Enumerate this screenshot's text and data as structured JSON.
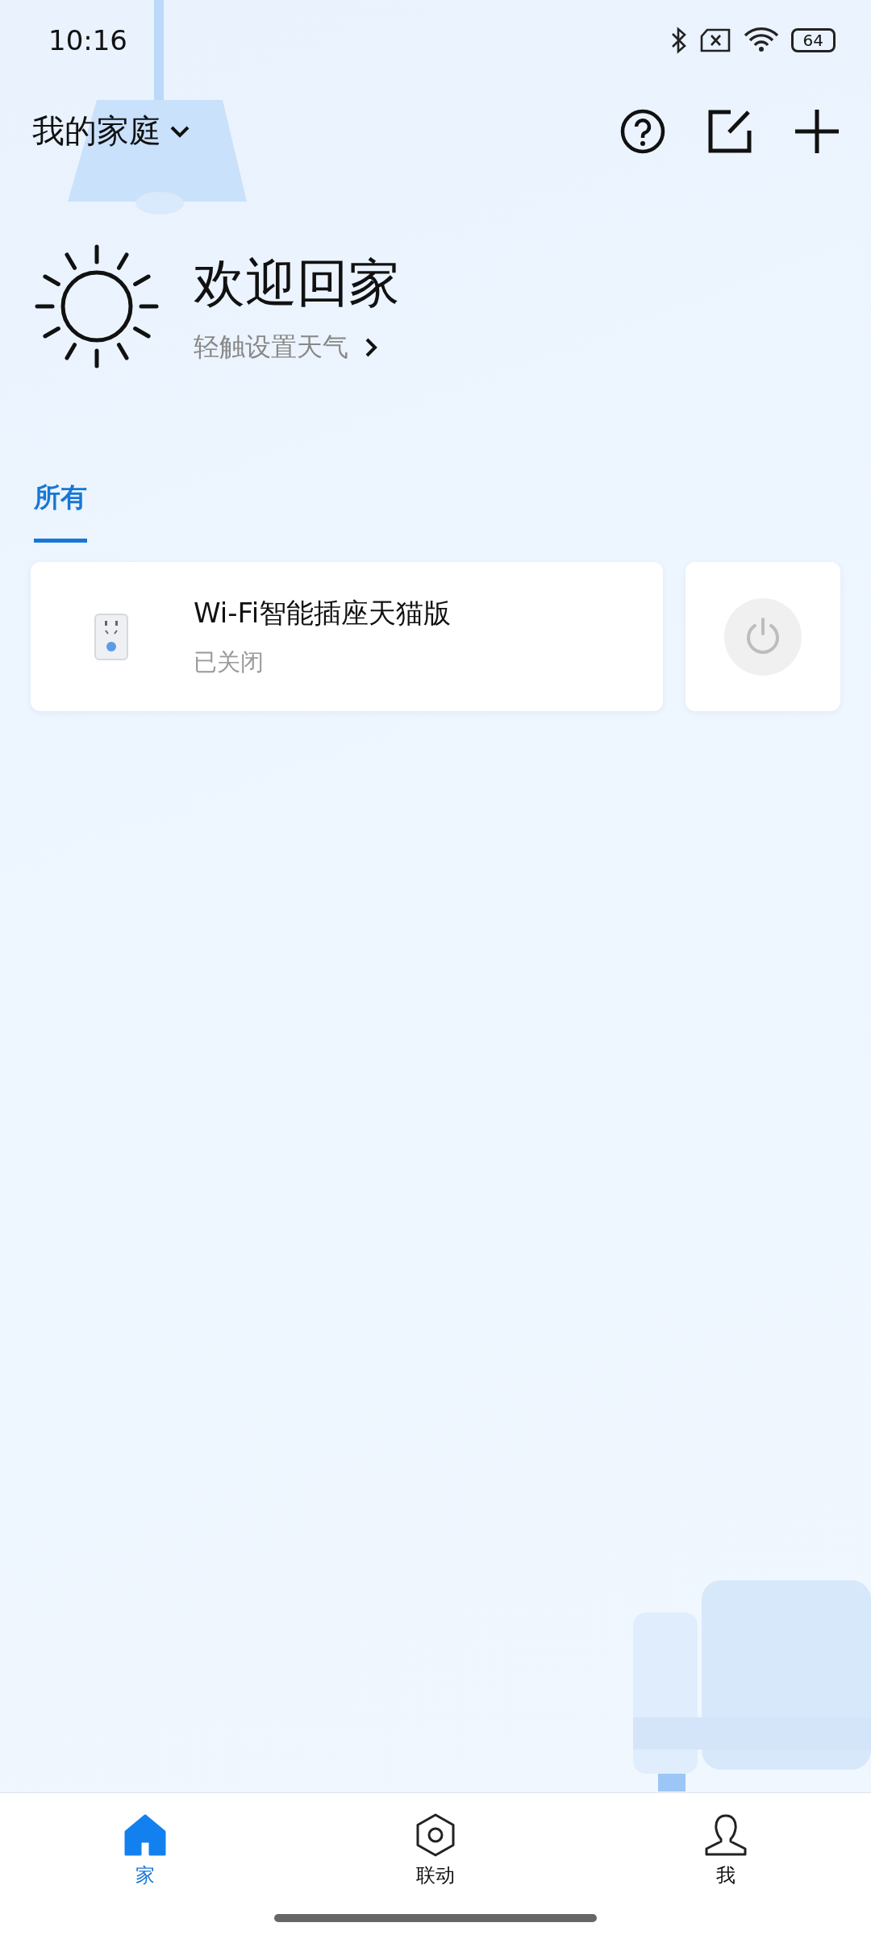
{
  "status_bar": {
    "time": "10:16",
    "battery": "64"
  },
  "header": {
    "home_name": "我的家庭"
  },
  "weather": {
    "title": "欢迎回家",
    "subtitle": "轻触设置天气"
  },
  "room_tabs": [
    {
      "label": "所有",
      "selected": true
    }
  ],
  "devices": [
    {
      "name": "Wi-Fi智能插座天猫版",
      "status": "已关闭",
      "on": false
    }
  ],
  "bottom_nav": [
    {
      "label": "家",
      "kind": "home",
      "selected": true
    },
    {
      "label": "联动",
      "kind": "automation",
      "selected": false
    },
    {
      "label": "我",
      "kind": "profile",
      "selected": false
    }
  ]
}
